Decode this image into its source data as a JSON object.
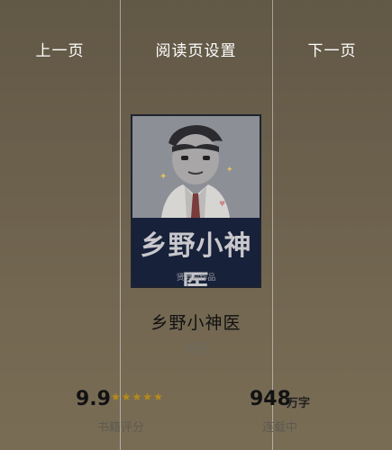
{
  "top_bar": {
    "prev_label": "上一页",
    "settings_label": "阅读页设置",
    "next_label": "下一页"
  },
  "cover": {
    "title_text": "乡野小神医",
    "author_text": "贤亮◎作品"
  },
  "book": {
    "title": "乡野小神医",
    "author": "贤亮"
  },
  "stats": {
    "rating_value": "9.9",
    "rating_stars": 5,
    "rating_label": "书籍评分",
    "word_count": "948",
    "word_unit": "万字",
    "status": "连载中"
  },
  "colors": {
    "star": "#b88a18",
    "cover_top": "#8d8f96",
    "cover_bottom": "#18213a"
  }
}
